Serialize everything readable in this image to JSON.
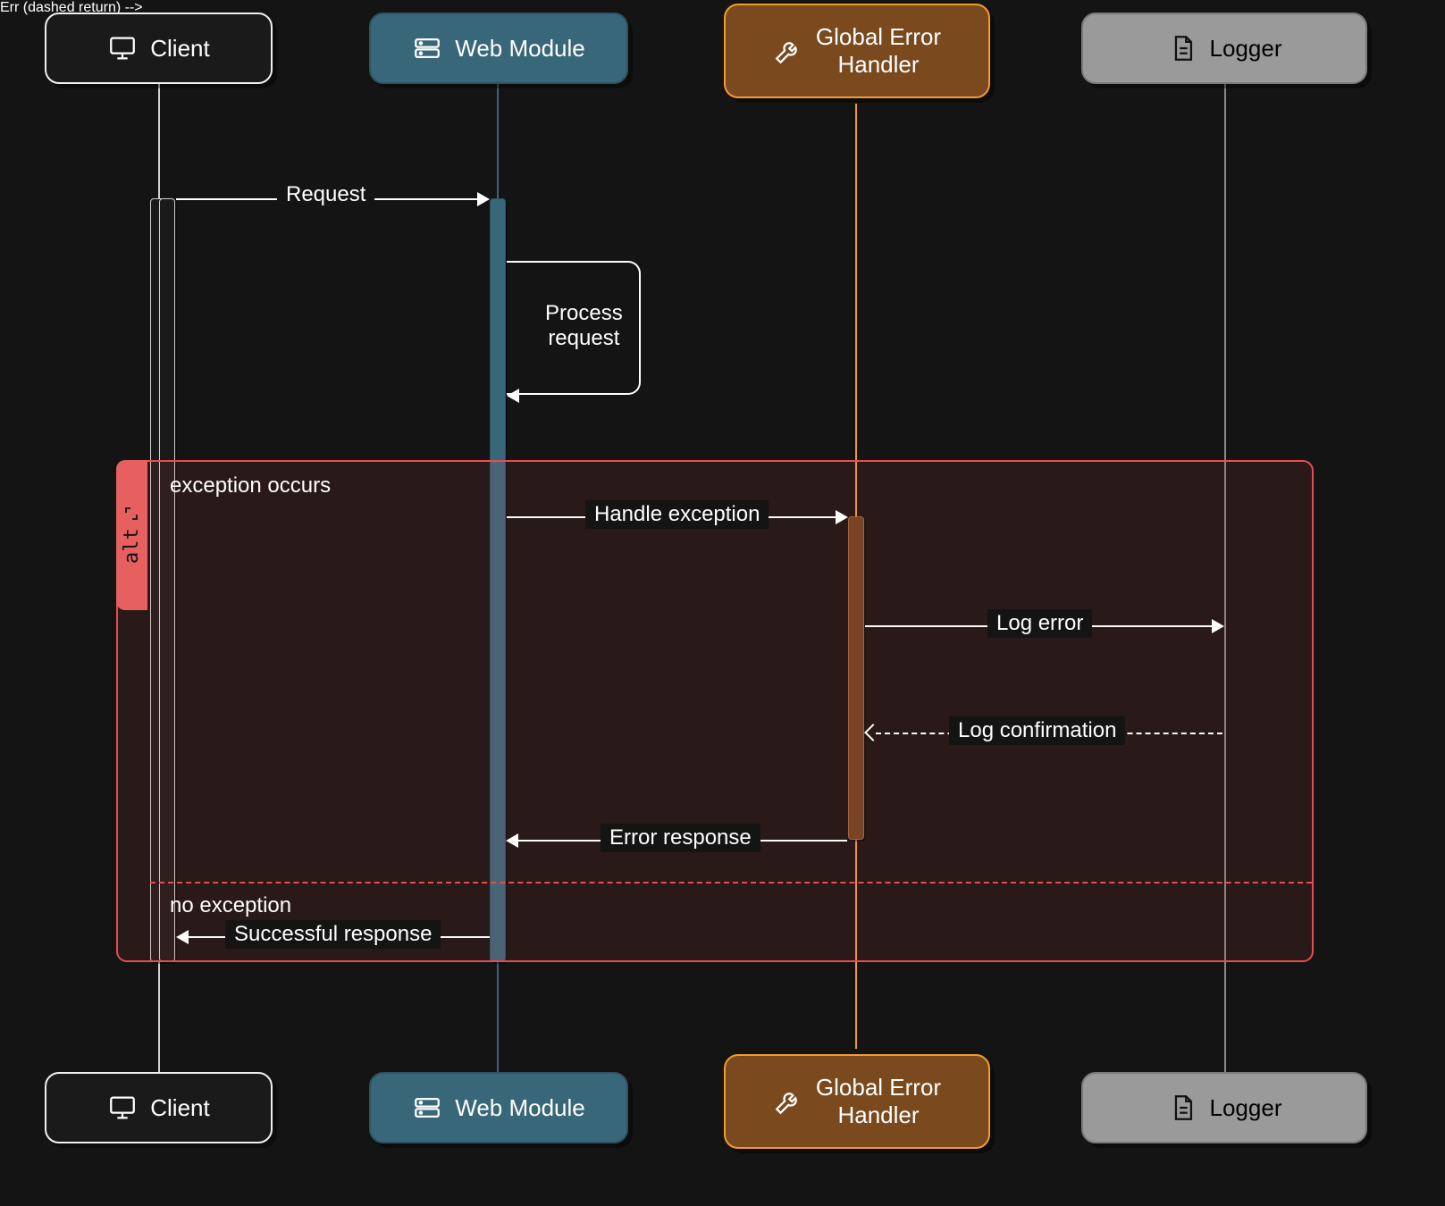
{
  "actors": {
    "client": {
      "label": "Client",
      "icon": "monitor-icon"
    },
    "web": {
      "label": "Web Module",
      "icon": "server-icon"
    },
    "err": {
      "label1": "Global Error",
      "label2": "Handler",
      "icon": "wrench-icon"
    },
    "log": {
      "label": "Logger",
      "icon": "document-icon"
    }
  },
  "messages": {
    "request": "Request",
    "process1": "Process",
    "process2": "request",
    "handle_exception": "Handle exception",
    "log_error": "Log error",
    "log_confirmation": "Log confirmation",
    "error_response": "Error response",
    "successful_response": "Successful response"
  },
  "alt": {
    "tag": "alt",
    "guard1": "exception occurs",
    "guard2": "no exception"
  },
  "colors": {
    "bg": "#141414",
    "client_border": "#f0f0f0",
    "web_fill": "#39677a",
    "err_fill": "#7a4a1e",
    "err_border": "#f29c2e",
    "log_fill": "#9a9a9a",
    "alt_border": "#e84d4d"
  }
}
